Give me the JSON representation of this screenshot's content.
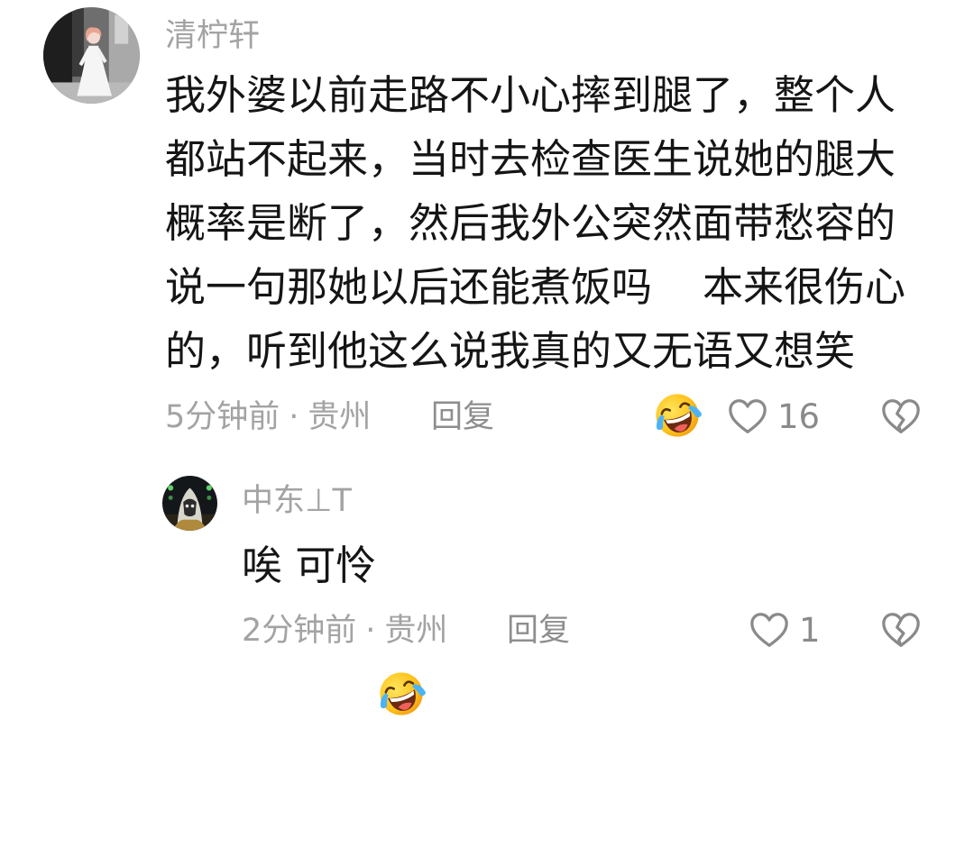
{
  "theme": {
    "background": "#ffffff",
    "text": "#151515",
    "muted": "#a3a3a3",
    "action": "#8e8e8e",
    "icon": "#8a8a8a"
  },
  "main_comment": {
    "username": "清柠轩",
    "content": [
      {
        "text": "我外婆以前走路不小心摔到腿了，整个人"
      },
      {
        "text": "都站不起来，当时去检查医生说她的腿大"
      },
      {
        "text": "概率是断了，然后我外公突然面带愁容的"
      },
      {
        "text": "说一句那她以后还能煮饭吗",
        "emoji": "laugh-cry-emoji",
        "text_after": "本来很伤心"
      },
      {
        "text": "的，听到他这么说我真的又无语又想笑"
      }
    ],
    "time": "5分钟前",
    "separator": "·",
    "location": "贵州",
    "reply_label": "回复",
    "like_icon": "heart-outline-icon",
    "like_count": "16",
    "dislike_icon": "broken-heart-icon"
  },
  "reply_comment": {
    "username": "中东⊥T",
    "text": "唉 可怜",
    "emoji": "laugh-cry-emoji",
    "time": "2分钟前",
    "separator": "·",
    "location": "贵州",
    "reply_label": "回复",
    "like_icon": "heart-outline-icon",
    "like_count": "1",
    "dislike_icon": "broken-heart-icon"
  }
}
